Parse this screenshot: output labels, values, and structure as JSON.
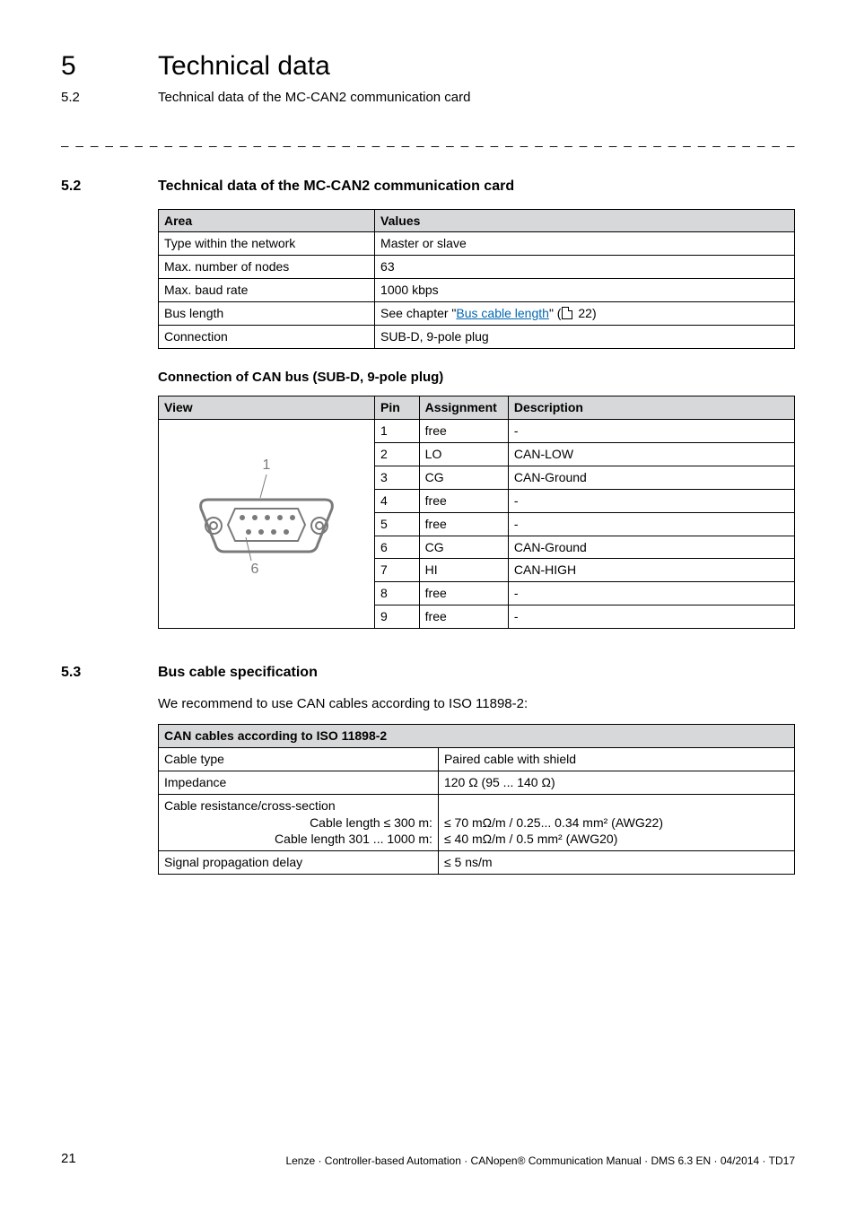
{
  "chapter": {
    "num": "5",
    "title": "Technical data"
  },
  "topSub": {
    "num": "5.2",
    "title": "Technical data of the MC-CAN2 communication card"
  },
  "sec52": {
    "num": "5.2",
    "title": "Technical data of the MC-CAN2 communication card",
    "headers": {
      "area": "Area",
      "values": "Values"
    },
    "rows": [
      {
        "area": "Type within the network",
        "value": "Master or slave"
      },
      {
        "area": "Max. number of nodes",
        "value": "63"
      },
      {
        "area": "Max. baud rate",
        "value": "1000 kbps"
      },
      {
        "area": "Bus length",
        "prefix": "See chapter \"",
        "link": "Bus cable length",
        "suffix": "\" (",
        "pageref": "22",
        "close": ")"
      },
      {
        "area": "Connection",
        "value": "SUB-D, 9-pole plug"
      }
    ]
  },
  "conn": {
    "heading": "Connection of CAN bus (SUB-D, 9-pole plug)",
    "headers": {
      "view": "View",
      "pin": "Pin",
      "assign": "Assignment",
      "desc": "Description"
    },
    "labels": {
      "top": "1",
      "bottom": "6"
    },
    "rows": [
      {
        "pin": "1",
        "assign": "free",
        "desc": "-"
      },
      {
        "pin": "2",
        "assign": "LO",
        "desc": "CAN-LOW"
      },
      {
        "pin": "3",
        "assign": "CG",
        "desc": "CAN-Ground"
      },
      {
        "pin": "4",
        "assign": "free",
        "desc": "-"
      },
      {
        "pin": "5",
        "assign": "free",
        "desc": "-"
      },
      {
        "pin": "6",
        "assign": "CG",
        "desc": "CAN-Ground"
      },
      {
        "pin": "7",
        "assign": "HI",
        "desc": "CAN-HIGH"
      },
      {
        "pin": "8",
        "assign": "free",
        "desc": "-"
      },
      {
        "pin": "9",
        "assign": "free",
        "desc": "-"
      }
    ]
  },
  "sec53": {
    "num": "5.3",
    "title": "Bus cable specification",
    "intro": "We recommend to use CAN cables according to ISO 11898-2:",
    "tableHeader": "CAN cables according to ISO 11898-2",
    "rows": {
      "cableType": {
        "label": "Cable type",
        "value": "Paired cable with shield"
      },
      "impedance": {
        "label": "Impedance",
        "value": "120 Ω (95 ... 140 Ω)"
      },
      "resist": {
        "label": "Cable resistance/cross-section",
        "sub1l": "Cable length ≤ 300 m:",
        "sub1v": "≤ 70 mΩ/m / 0.25... 0.34 mm² (AWG22)",
        "sub2l": "Cable length 301 ... 1000 m:",
        "sub2v": "≤ 40 mΩ/m / 0.5 mm² (AWG20)"
      },
      "delay": {
        "label": "Signal propagation delay",
        "value": "≤ 5 ns/m"
      }
    }
  },
  "footer": {
    "page": "21",
    "text": "Lenze · Controller-based Automation · CANopen® Communication Manual · DMS 6.3 EN · 04/2014 · TD17"
  }
}
